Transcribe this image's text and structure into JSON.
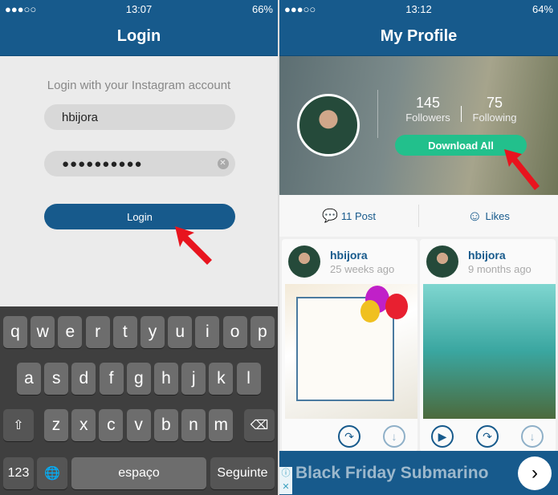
{
  "left": {
    "status": {
      "signal": "●●●○○",
      "time": "13:07",
      "battery": "66%"
    },
    "title": "Login",
    "prompt": "Login with your Instagram account",
    "username": "hbijora",
    "password": "●●●●●●●●●●",
    "login_label": "Login",
    "keyboard": {
      "row1": [
        "q",
        "w",
        "e",
        "r",
        "t",
        "y",
        "u",
        "i",
        "o",
        "p"
      ],
      "row2": [
        "a",
        "s",
        "d",
        "f",
        "g",
        "h",
        "j",
        "k",
        "l"
      ],
      "row3": [
        "z",
        "x",
        "c",
        "v",
        "b",
        "n",
        "m"
      ],
      "shift": "⇧",
      "backspace": "⌫",
      "numbers": "123",
      "globe": "🌐",
      "space": "espaço",
      "return": "Seguinte"
    }
  },
  "right": {
    "status": {
      "signal": "●●●○○",
      "time": "13:12",
      "battery": "64%"
    },
    "title": "My Profile",
    "followers": {
      "count": "145",
      "label": "Followers"
    },
    "following": {
      "count": "75",
      "label": "Following"
    },
    "download_all": "Download All",
    "posts_tab": "11 Post",
    "likes_tab": "Likes",
    "cards": [
      {
        "user": "hbijora",
        "time": "25 weeks ago"
      },
      {
        "user": "hbijora",
        "time": "9 months ago"
      }
    ],
    "ad": {
      "text": "Black Friday Submarino"
    }
  },
  "colors": {
    "brand": "#175a8c",
    "accent": "#22c08c",
    "arrow": "#e8141e"
  }
}
